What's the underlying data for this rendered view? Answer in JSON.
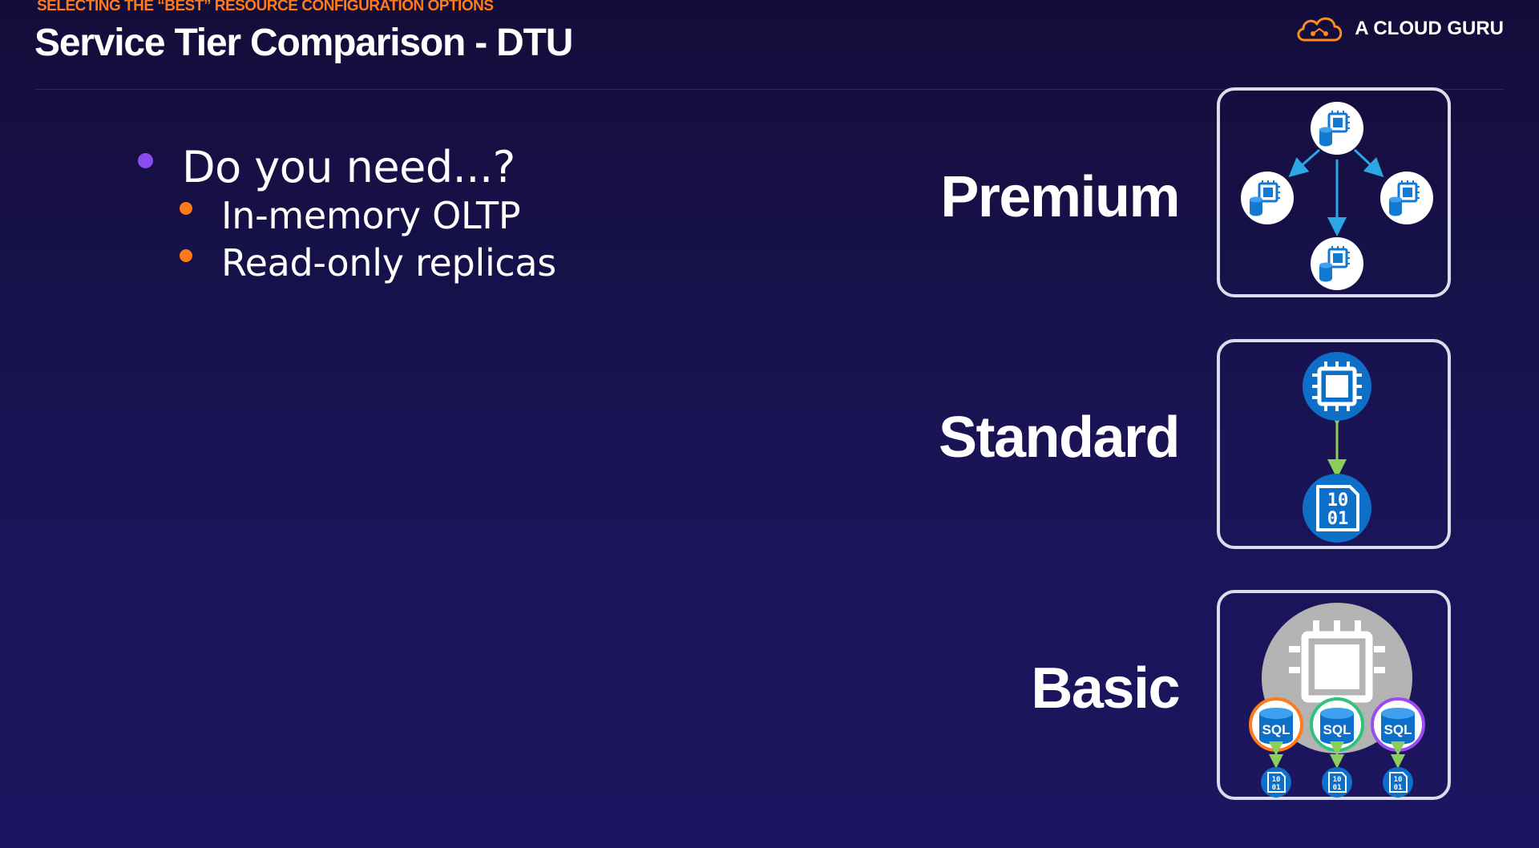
{
  "header": {
    "eyebrow": "SELECTING THE “BEST” RESOURCE CONFIGURATION OPTIONS",
    "title": "Service Tier Comparison - DTU",
    "brand": "A CLOUD GURU"
  },
  "bullets": {
    "main": "Do you need...?",
    "sub": [
      "In-memory OLTP",
      "Read-only replicas"
    ]
  },
  "tiers": [
    {
      "name": "Premium",
      "icon": "replicated-database-icon"
    },
    {
      "name": "Standard",
      "icon": "processor-storage-icon"
    },
    {
      "name": "Basic",
      "icon": "shared-pool-sql-icon"
    }
  ],
  "icon_text": {
    "sql": "SQL",
    "binary_top": "10",
    "binary_bottom": "01"
  },
  "colors": {
    "eyebrow": "#ff7a1a",
    "bullet_main": "#8a4cf0",
    "bullet_sub": "#ff7a1a",
    "icon_blue": "#0e6fc9",
    "arrow_blue": "#2ba7e6",
    "arrow_green": "#8bcf5a"
  }
}
